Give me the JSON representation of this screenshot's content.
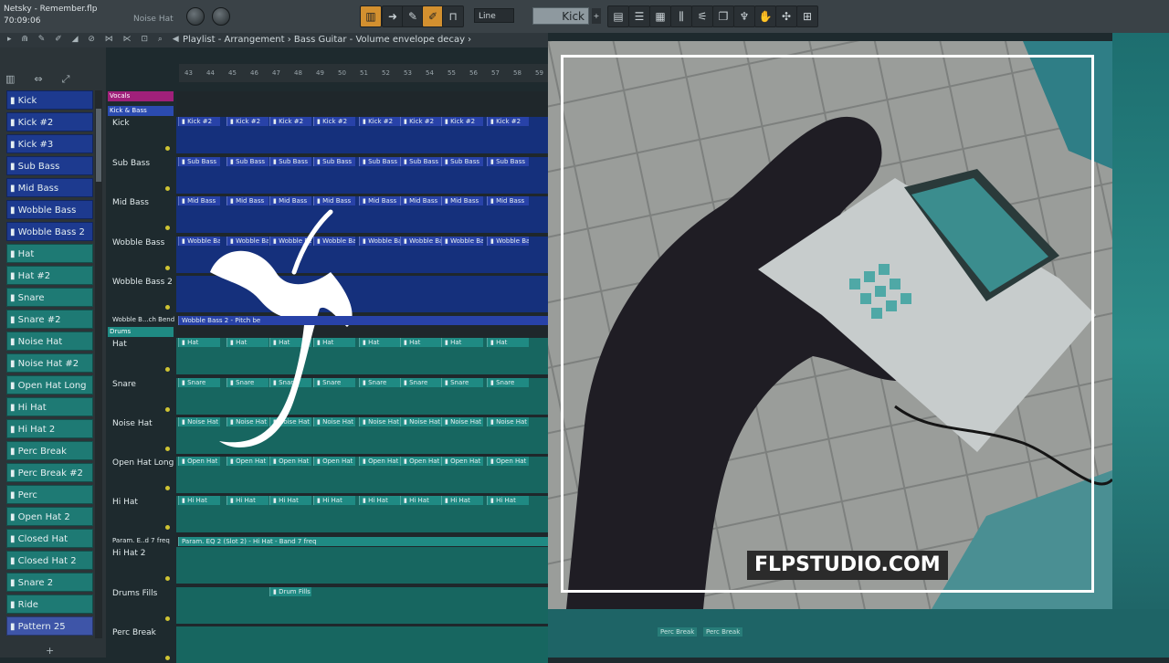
{
  "window": {
    "title": "Netsky - Remember.flp",
    "time": "70:09:06",
    "hint": "Noise Hat"
  },
  "toolbar": {
    "snap_value": "Line",
    "pattern_name": "Kick"
  },
  "breadcrumb": "Playlist - Arrangement  ›  Bass Guitar - Volume envelope decay ›",
  "ruler": [
    "43",
    "44",
    "45",
    "46",
    "47",
    "48",
    "49",
    "50",
    "51",
    "52",
    "53",
    "54",
    "55",
    "56",
    "57",
    "58",
    "59"
  ],
  "channels": [
    {
      "label": "Kick",
      "color": "blue"
    },
    {
      "label": "Kick #2",
      "color": "blue"
    },
    {
      "label": "Kick #3",
      "color": "blue"
    },
    {
      "label": "Sub Bass",
      "color": "blue"
    },
    {
      "label": "Mid Bass",
      "color": "blue"
    },
    {
      "label": "Wobble Bass",
      "color": "blue"
    },
    {
      "label": "Wobble Bass 2",
      "color": "blue"
    },
    {
      "label": "Hat",
      "color": "teal"
    },
    {
      "label": "Hat #2",
      "color": "teal"
    },
    {
      "label": "Snare",
      "color": "teal"
    },
    {
      "label": "Snare #2",
      "color": "teal"
    },
    {
      "label": "Noise Hat",
      "color": "teal"
    },
    {
      "label": "Noise Hat #2",
      "color": "teal"
    },
    {
      "label": "Open Hat Long",
      "color": "teal"
    },
    {
      "label": "Hi Hat",
      "color": "teal"
    },
    {
      "label": "Hi Hat 2",
      "color": "teal"
    },
    {
      "label": "Perc Break",
      "color": "teal"
    },
    {
      "label": "Perc Break #2",
      "color": "teal"
    },
    {
      "label": "Perc",
      "color": "teal"
    },
    {
      "label": "Open Hat 2",
      "color": "teal"
    },
    {
      "label": "Closed Hat",
      "color": "teal"
    },
    {
      "label": "Closed Hat 2",
      "color": "teal"
    },
    {
      "label": "Snare 2",
      "color": "teal"
    },
    {
      "label": "Ride",
      "color": "teal"
    },
    {
      "label": "Pattern 25",
      "color": "pat"
    }
  ],
  "groups": {
    "vocals": "Vocals",
    "kick_bass": "Kick & Bass",
    "drums": "Drums"
  },
  "tracks": [
    {
      "label": "Kick",
      "clip": "Kick #2",
      "color": "blue"
    },
    {
      "label": "Sub Bass",
      "clip": "Sub Bass",
      "color": "blue"
    },
    {
      "label": "Mid Bass",
      "clip": "Mid Bass",
      "color": "blue"
    },
    {
      "label": "Wobble Bass",
      "clip": "Wobble Bass",
      "color": "blue"
    },
    {
      "label": "Wobble Bass 2",
      "clip": "",
      "color": "blue"
    },
    {
      "label": "Hat",
      "clip": "Hat",
      "color": "teal"
    },
    {
      "label": "Snare",
      "clip": "Snare",
      "color": "teal"
    },
    {
      "label": "Noise Hat",
      "clip": "Noise Hat",
      "color": "teal"
    },
    {
      "label": "Open Hat Long",
      "clip": "Open Hat Long",
      "color": "teal"
    },
    {
      "label": "Hi Hat",
      "clip": "Hi Hat",
      "color": "teal"
    },
    {
      "label": "Hi Hat 2",
      "clip": "",
      "color": "teal"
    },
    {
      "label": "Drums Fills",
      "clip": "Drum Fills",
      "color": "teal"
    },
    {
      "label": "Perc Break",
      "clip": "",
      "color": "teal"
    }
  ],
  "automation_labels": {
    "wobble_bend": "Wobble B...ch Bend",
    "wobble_clip": "Wobble Bass 2 - Pitch be",
    "param": "Param. E..d 7 freq",
    "param_clip": "Param. EQ 2 (Slot 2) - Hi Hat - Band 7 freq"
  },
  "brand": "FLPSTUDIO.COM",
  "bottom_clips": [
    "Perc Break",
    "Perc Break"
  ]
}
